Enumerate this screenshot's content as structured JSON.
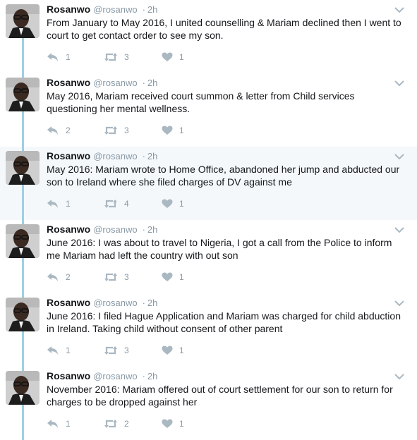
{
  "tweets": [
    {
      "name": "Rosanwo",
      "handle": "@rosanwo",
      "time": "2h",
      "text": "From January to May 2016, I united counselling & Mariam declined then I went to court to get contact order to see my son.",
      "replies": "1",
      "retweets": "3",
      "likes": "1",
      "highlighted": false
    },
    {
      "name": "Rosanwo",
      "handle": "@rosanwo",
      "time": "2h",
      "text": "May 2016, Mariam received court summon & letter from Child services questioning her mental wellness.",
      "replies": "2",
      "retweets": "3",
      "likes": "1",
      "highlighted": false
    },
    {
      "name": "Rosanwo",
      "handle": "@rosanwo",
      "time": "2h",
      "text": "May 2016: Mariam wrote to Home Office, abandoned her jump and abducted our son to Ireland where she filed charges of DV against me",
      "replies": "1",
      "retweets": "4",
      "likes": "1",
      "highlighted": true
    },
    {
      "name": "Rosanwo",
      "handle": "@rosanwo",
      "time": "2h",
      "text": "June 2016: I was about to travel to Nigeria, I got a call from the Police to inform me Mariam had left the country with out son",
      "replies": "2",
      "retweets": "3",
      "likes": "1",
      "highlighted": false
    },
    {
      "name": "Rosanwo",
      "handle": "@rosanwo",
      "time": "2h",
      "text": "June 2016: I filed Hague Application and Mariam was charged for child abduction in Ireland. Taking child without consent of other parent",
      "replies": "1",
      "retweets": "3",
      "likes": "1",
      "highlighted": false
    },
    {
      "name": "Rosanwo",
      "handle": "@rosanwo",
      "time": "2h",
      "text": "November 2016: Mariam offered out of court settlement for our son to return for charges to be dropped against her",
      "replies": "1",
      "retweets": "2",
      "likes": "1",
      "highlighted": false
    }
  ],
  "icons": {
    "reply": "reply-icon",
    "retweet": "retweet-icon",
    "like": "heart-icon",
    "caret": "chevron-down-icon"
  },
  "colors": {
    "thread_line": "#9ecfe7",
    "highlight_bg": "#f5f8fa",
    "meta_text": "#8899a6",
    "icon": "#aab8c2"
  }
}
